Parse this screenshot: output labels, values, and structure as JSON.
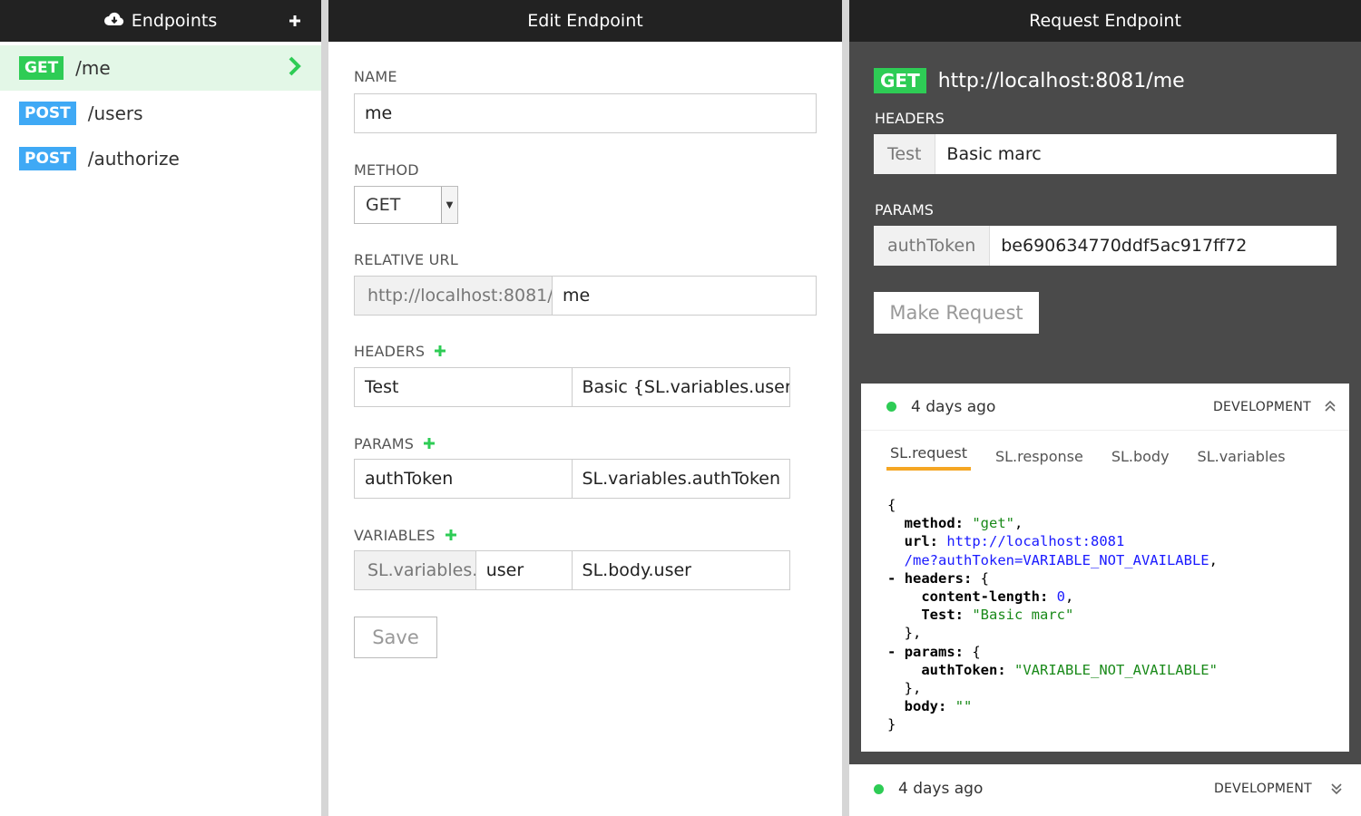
{
  "endpoints_pane": {
    "title": "Endpoints",
    "items": [
      {
        "method": "GET",
        "path": "/me",
        "active": true
      },
      {
        "method": "POST",
        "path": "/users",
        "active": false
      },
      {
        "method": "POST",
        "path": "/authorize",
        "active": false
      }
    ]
  },
  "edit_pane": {
    "title": "Edit Endpoint",
    "name_label": "NAME",
    "name_value": "me",
    "method_label": "METHOD",
    "method_value": "GET",
    "relative_url_label": "RELATIVE URL",
    "base_url": "http://localhost:8081/",
    "relative_url_value": "me",
    "headers_label": "HEADERS",
    "header_key": "Test",
    "header_value": "Basic {SL.variables.usern",
    "params_label": "PARAMS",
    "param_key": "authToken",
    "param_value": "SL.variables.authToken",
    "variables_label": "VARIABLES",
    "variable_prefix": "SL.variables.",
    "variable_name": "user",
    "variable_value": "SL.body.user",
    "save_label": "Save"
  },
  "request_pane": {
    "title": "Request Endpoint",
    "method": "GET",
    "url": "http://localhost:8081/me",
    "headers_label": "HEADERS",
    "header_key": "Test",
    "header_value": "Basic marc",
    "params_label": "PARAMS",
    "param_key": "authToken",
    "param_value": "be690634770ddf5ac917ff72",
    "make_request_label": "Make Request",
    "history": [
      {
        "time": "4 days ago",
        "env": "DEVELOPMENT",
        "expanded": true,
        "tabs": [
          "SL.request",
          "SL.response",
          "SL.body",
          "SL.variables"
        ],
        "active_tab": "SL.request",
        "json": {
          "open": "{",
          "method_key": "method:",
          "method_val": "\"get\"",
          "url_key": "url:",
          "url_val_1": "http://localhost:8081",
          "url_val_2": "/me?authToken=VARIABLE_NOT_AVAILABLE",
          "headers_key": "headers:",
          "cl_key": "content-length:",
          "cl_val": "0",
          "test_key": "Test:",
          "test_val": "\"Basic marc\"",
          "params_key": "params:",
          "auth_key": "authToken:",
          "auth_val": "\"VARIABLE_NOT_AVAILABLE\"",
          "body_key": "body:",
          "body_val": "\"\"",
          "close": "}"
        }
      },
      {
        "time": "4 days ago",
        "env": "DEVELOPMENT",
        "expanded": false
      }
    ]
  },
  "colors": {
    "get": "#2ecc55",
    "post": "#3fa9f5",
    "header_bg": "#222222",
    "request_pane_bg": "#4a4a4a",
    "active_tab_underline": "#f5a623"
  },
  "icons": [
    "cloud-icon",
    "plus-icon",
    "chevron-right-icon",
    "add-icon",
    "select-arrow-icon",
    "status-dot-icon",
    "chevron-double-up-icon",
    "chevron-double-down-icon"
  ]
}
